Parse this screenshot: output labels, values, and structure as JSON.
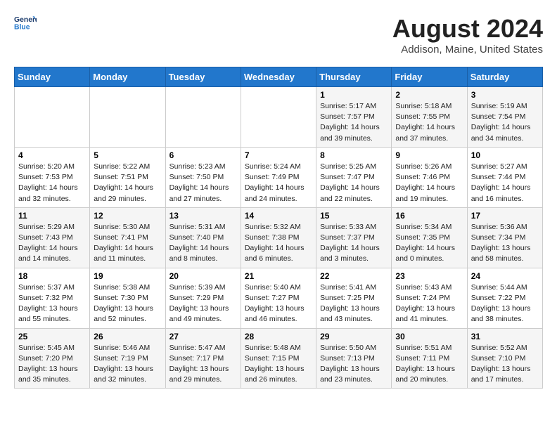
{
  "logo": {
    "line1": "General",
    "line2": "Blue"
  },
  "title": "August 2024",
  "subtitle": "Addison, Maine, United States",
  "days_of_week": [
    "Sunday",
    "Monday",
    "Tuesday",
    "Wednesday",
    "Thursday",
    "Friday",
    "Saturday"
  ],
  "weeks": [
    [
      {
        "day": "",
        "info": ""
      },
      {
        "day": "",
        "info": ""
      },
      {
        "day": "",
        "info": ""
      },
      {
        "day": "",
        "info": ""
      },
      {
        "day": "1",
        "info": "Sunrise: 5:17 AM\nSunset: 7:57 PM\nDaylight: 14 hours\nand 39 minutes."
      },
      {
        "day": "2",
        "info": "Sunrise: 5:18 AM\nSunset: 7:55 PM\nDaylight: 14 hours\nand 37 minutes."
      },
      {
        "day": "3",
        "info": "Sunrise: 5:19 AM\nSunset: 7:54 PM\nDaylight: 14 hours\nand 34 minutes."
      }
    ],
    [
      {
        "day": "4",
        "info": "Sunrise: 5:20 AM\nSunset: 7:53 PM\nDaylight: 14 hours\nand 32 minutes."
      },
      {
        "day": "5",
        "info": "Sunrise: 5:22 AM\nSunset: 7:51 PM\nDaylight: 14 hours\nand 29 minutes."
      },
      {
        "day": "6",
        "info": "Sunrise: 5:23 AM\nSunset: 7:50 PM\nDaylight: 14 hours\nand 27 minutes."
      },
      {
        "day": "7",
        "info": "Sunrise: 5:24 AM\nSunset: 7:49 PM\nDaylight: 14 hours\nand 24 minutes."
      },
      {
        "day": "8",
        "info": "Sunrise: 5:25 AM\nSunset: 7:47 PM\nDaylight: 14 hours\nand 22 minutes."
      },
      {
        "day": "9",
        "info": "Sunrise: 5:26 AM\nSunset: 7:46 PM\nDaylight: 14 hours\nand 19 minutes."
      },
      {
        "day": "10",
        "info": "Sunrise: 5:27 AM\nSunset: 7:44 PM\nDaylight: 14 hours\nand 16 minutes."
      }
    ],
    [
      {
        "day": "11",
        "info": "Sunrise: 5:29 AM\nSunset: 7:43 PM\nDaylight: 14 hours\nand 14 minutes."
      },
      {
        "day": "12",
        "info": "Sunrise: 5:30 AM\nSunset: 7:41 PM\nDaylight: 14 hours\nand 11 minutes."
      },
      {
        "day": "13",
        "info": "Sunrise: 5:31 AM\nSunset: 7:40 PM\nDaylight: 14 hours\nand 8 minutes."
      },
      {
        "day": "14",
        "info": "Sunrise: 5:32 AM\nSunset: 7:38 PM\nDaylight: 14 hours\nand 6 minutes."
      },
      {
        "day": "15",
        "info": "Sunrise: 5:33 AM\nSunset: 7:37 PM\nDaylight: 14 hours\nand 3 minutes."
      },
      {
        "day": "16",
        "info": "Sunrise: 5:34 AM\nSunset: 7:35 PM\nDaylight: 14 hours\nand 0 minutes."
      },
      {
        "day": "17",
        "info": "Sunrise: 5:36 AM\nSunset: 7:34 PM\nDaylight: 13 hours\nand 58 minutes."
      }
    ],
    [
      {
        "day": "18",
        "info": "Sunrise: 5:37 AM\nSunset: 7:32 PM\nDaylight: 13 hours\nand 55 minutes."
      },
      {
        "day": "19",
        "info": "Sunrise: 5:38 AM\nSunset: 7:30 PM\nDaylight: 13 hours\nand 52 minutes."
      },
      {
        "day": "20",
        "info": "Sunrise: 5:39 AM\nSunset: 7:29 PM\nDaylight: 13 hours\nand 49 minutes."
      },
      {
        "day": "21",
        "info": "Sunrise: 5:40 AM\nSunset: 7:27 PM\nDaylight: 13 hours\nand 46 minutes."
      },
      {
        "day": "22",
        "info": "Sunrise: 5:41 AM\nSunset: 7:25 PM\nDaylight: 13 hours\nand 43 minutes."
      },
      {
        "day": "23",
        "info": "Sunrise: 5:43 AM\nSunset: 7:24 PM\nDaylight: 13 hours\nand 41 minutes."
      },
      {
        "day": "24",
        "info": "Sunrise: 5:44 AM\nSunset: 7:22 PM\nDaylight: 13 hours\nand 38 minutes."
      }
    ],
    [
      {
        "day": "25",
        "info": "Sunrise: 5:45 AM\nSunset: 7:20 PM\nDaylight: 13 hours\nand 35 minutes."
      },
      {
        "day": "26",
        "info": "Sunrise: 5:46 AM\nSunset: 7:19 PM\nDaylight: 13 hours\nand 32 minutes."
      },
      {
        "day": "27",
        "info": "Sunrise: 5:47 AM\nSunset: 7:17 PM\nDaylight: 13 hours\nand 29 minutes."
      },
      {
        "day": "28",
        "info": "Sunrise: 5:48 AM\nSunset: 7:15 PM\nDaylight: 13 hours\nand 26 minutes."
      },
      {
        "day": "29",
        "info": "Sunrise: 5:50 AM\nSunset: 7:13 PM\nDaylight: 13 hours\nand 23 minutes."
      },
      {
        "day": "30",
        "info": "Sunrise: 5:51 AM\nSunset: 7:11 PM\nDaylight: 13 hours\nand 20 minutes."
      },
      {
        "day": "31",
        "info": "Sunrise: 5:52 AM\nSunset: 7:10 PM\nDaylight: 13 hours\nand 17 minutes."
      }
    ]
  ]
}
